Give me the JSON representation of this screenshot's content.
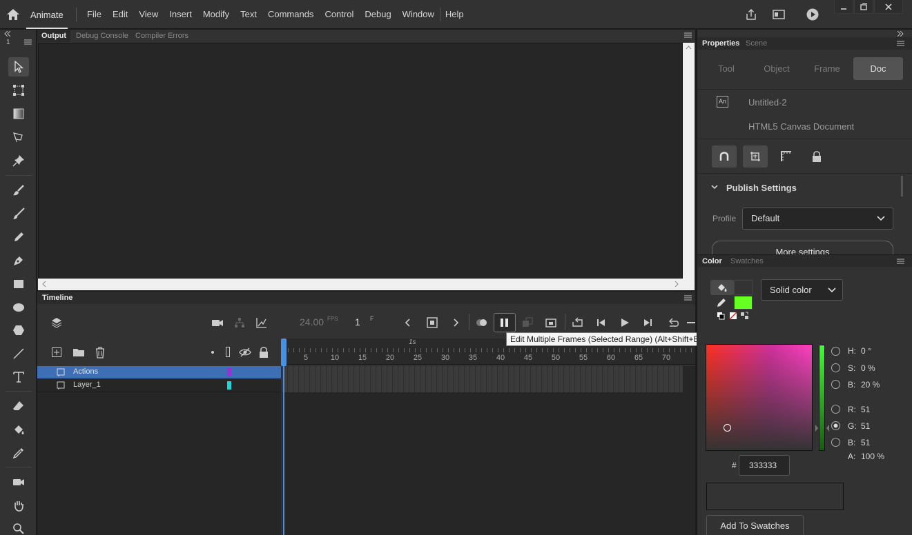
{
  "app": {
    "name": "Animate"
  },
  "menu": [
    "File",
    "Edit",
    "View",
    "Insert",
    "Modify",
    "Text",
    "Commands",
    "Control",
    "Debug",
    "Window",
    "Help"
  ],
  "output_panel": {
    "tabs": [
      "Output",
      "Debug Console",
      "Compiler Errors"
    ],
    "active_tab": "Output"
  },
  "toolbar": {
    "collapse_label": "1"
  },
  "timeline": {
    "title": "Timeline",
    "fps": "24.00",
    "fps_unit": "FPS",
    "current_frame": "1",
    "frame_unit": "F",
    "ruler_marker": "1s",
    "ticks": [
      "5",
      "10",
      "15",
      "20",
      "25",
      "30",
      "35",
      "40",
      "45",
      "50",
      "55",
      "60",
      "65",
      "70"
    ],
    "layers": [
      {
        "name": "Actions",
        "color": "#9b30d9",
        "selected": true
      },
      {
        "name": "Layer_1",
        "color": "#20d6d6",
        "selected": false
      }
    ],
    "tooltip": "Edit Multiple Frames (Selected Range) (Alt+Shift+E)"
  },
  "properties": {
    "tabs": [
      "Properties",
      "Scene"
    ],
    "segments": [
      "Tool",
      "Object",
      "Frame",
      "Doc"
    ],
    "active_segment": "Doc",
    "doc_badge": "An",
    "doc_name": "Untitled-2",
    "doc_type": "HTML5 Canvas Document",
    "publish": {
      "title": "Publish Settings",
      "profile_label": "Profile",
      "profile_value": "Default",
      "more_button": "More settings"
    }
  },
  "color_panel": {
    "tabs": [
      "Color",
      "Swatches"
    ],
    "fill_type": "Solid color",
    "fill_swatch": "#333333",
    "stroke_swatch": "#66ff22",
    "hsb": {
      "h": {
        "label": "H:",
        "value": "0 °"
      },
      "s": {
        "label": "S:",
        "value": "0 %"
      },
      "b": {
        "label": "B:",
        "value": "20 %"
      }
    },
    "rgb": {
      "r": {
        "label": "R:",
        "value": "51"
      },
      "g": {
        "label": "G:",
        "value": "51"
      },
      "b": {
        "label": "B:",
        "value": "51"
      }
    },
    "alpha": {
      "label": "A:",
      "value": "100 %"
    },
    "hex_label": "#",
    "hex": "333333",
    "add_swatch_button": "Add To Swatches"
  }
}
